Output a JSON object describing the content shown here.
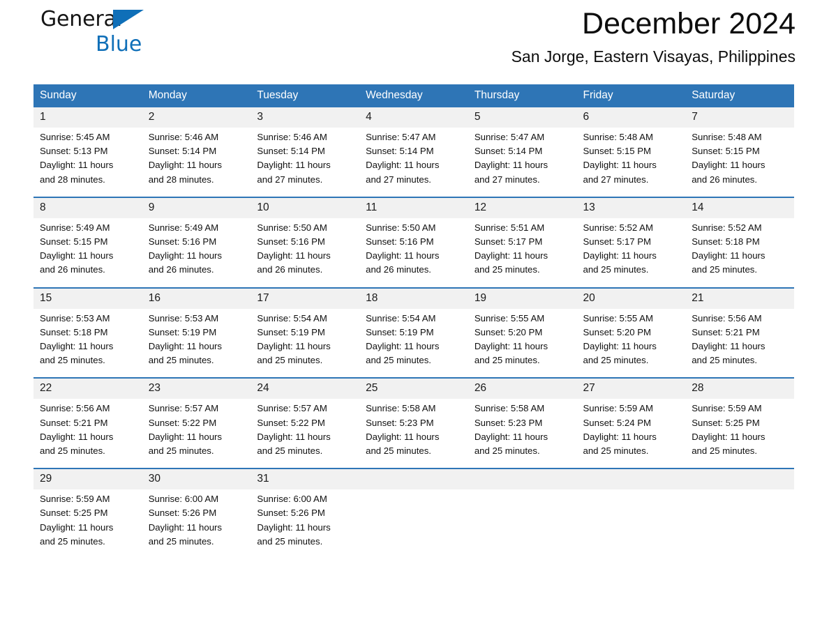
{
  "brand": {
    "name_part1": "General",
    "name_part2": "Blue",
    "triangle_color": "#0F6FB8"
  },
  "header": {
    "month_title": "December 2024",
    "location": "San Jorge, Eastern Visayas, Philippines"
  },
  "theme": {
    "header_blue": "#2E75B6",
    "daynum_background": "#F1F1F1",
    "text_color": "#101010"
  },
  "calendar": {
    "weekday_headers": [
      "Sunday",
      "Monday",
      "Tuesday",
      "Wednesday",
      "Thursday",
      "Friday",
      "Saturday"
    ],
    "weeks": [
      {
        "daynums": [
          "1",
          "2",
          "3",
          "4",
          "5",
          "6",
          "7"
        ],
        "cells": [
          {
            "sunrise": "Sunrise: 5:45 AM",
            "sunset": "Sunset: 5:13 PM",
            "daylight1": "Daylight: 11 hours",
            "daylight2": "and 28 minutes."
          },
          {
            "sunrise": "Sunrise: 5:46 AM",
            "sunset": "Sunset: 5:14 PM",
            "daylight1": "Daylight: 11 hours",
            "daylight2": "and 28 minutes."
          },
          {
            "sunrise": "Sunrise: 5:46 AM",
            "sunset": "Sunset: 5:14 PM",
            "daylight1": "Daylight: 11 hours",
            "daylight2": "and 27 minutes."
          },
          {
            "sunrise": "Sunrise: 5:47 AM",
            "sunset": "Sunset: 5:14 PM",
            "daylight1": "Daylight: 11 hours",
            "daylight2": "and 27 minutes."
          },
          {
            "sunrise": "Sunrise: 5:47 AM",
            "sunset": "Sunset: 5:14 PM",
            "daylight1": "Daylight: 11 hours",
            "daylight2": "and 27 minutes."
          },
          {
            "sunrise": "Sunrise: 5:48 AM",
            "sunset": "Sunset: 5:15 PM",
            "daylight1": "Daylight: 11 hours",
            "daylight2": "and 27 minutes."
          },
          {
            "sunrise": "Sunrise: 5:48 AM",
            "sunset": "Sunset: 5:15 PM",
            "daylight1": "Daylight: 11 hours",
            "daylight2": "and 26 minutes."
          }
        ]
      },
      {
        "daynums": [
          "8",
          "9",
          "10",
          "11",
          "12",
          "13",
          "14"
        ],
        "cells": [
          {
            "sunrise": "Sunrise: 5:49 AM",
            "sunset": "Sunset: 5:15 PM",
            "daylight1": "Daylight: 11 hours",
            "daylight2": "and 26 minutes."
          },
          {
            "sunrise": "Sunrise: 5:49 AM",
            "sunset": "Sunset: 5:16 PM",
            "daylight1": "Daylight: 11 hours",
            "daylight2": "and 26 minutes."
          },
          {
            "sunrise": "Sunrise: 5:50 AM",
            "sunset": "Sunset: 5:16 PM",
            "daylight1": "Daylight: 11 hours",
            "daylight2": "and 26 minutes."
          },
          {
            "sunrise": "Sunrise: 5:50 AM",
            "sunset": "Sunset: 5:16 PM",
            "daylight1": "Daylight: 11 hours",
            "daylight2": "and 26 minutes."
          },
          {
            "sunrise": "Sunrise: 5:51 AM",
            "sunset": "Sunset: 5:17 PM",
            "daylight1": "Daylight: 11 hours",
            "daylight2": "and 25 minutes."
          },
          {
            "sunrise": "Sunrise: 5:52 AM",
            "sunset": "Sunset: 5:17 PM",
            "daylight1": "Daylight: 11 hours",
            "daylight2": "and 25 minutes."
          },
          {
            "sunrise": "Sunrise: 5:52 AM",
            "sunset": "Sunset: 5:18 PM",
            "daylight1": "Daylight: 11 hours",
            "daylight2": "and 25 minutes."
          }
        ]
      },
      {
        "daynums": [
          "15",
          "16",
          "17",
          "18",
          "19",
          "20",
          "21"
        ],
        "cells": [
          {
            "sunrise": "Sunrise: 5:53 AM",
            "sunset": "Sunset: 5:18 PM",
            "daylight1": "Daylight: 11 hours",
            "daylight2": "and 25 minutes."
          },
          {
            "sunrise": "Sunrise: 5:53 AM",
            "sunset": "Sunset: 5:19 PM",
            "daylight1": "Daylight: 11 hours",
            "daylight2": "and 25 minutes."
          },
          {
            "sunrise": "Sunrise: 5:54 AM",
            "sunset": "Sunset: 5:19 PM",
            "daylight1": "Daylight: 11 hours",
            "daylight2": "and 25 minutes."
          },
          {
            "sunrise": "Sunrise: 5:54 AM",
            "sunset": "Sunset: 5:19 PM",
            "daylight1": "Daylight: 11 hours",
            "daylight2": "and 25 minutes."
          },
          {
            "sunrise": "Sunrise: 5:55 AM",
            "sunset": "Sunset: 5:20 PM",
            "daylight1": "Daylight: 11 hours",
            "daylight2": "and 25 minutes."
          },
          {
            "sunrise": "Sunrise: 5:55 AM",
            "sunset": "Sunset: 5:20 PM",
            "daylight1": "Daylight: 11 hours",
            "daylight2": "and 25 minutes."
          },
          {
            "sunrise": "Sunrise: 5:56 AM",
            "sunset": "Sunset: 5:21 PM",
            "daylight1": "Daylight: 11 hours",
            "daylight2": "and 25 minutes."
          }
        ]
      },
      {
        "daynums": [
          "22",
          "23",
          "24",
          "25",
          "26",
          "27",
          "28"
        ],
        "cells": [
          {
            "sunrise": "Sunrise: 5:56 AM",
            "sunset": "Sunset: 5:21 PM",
            "daylight1": "Daylight: 11 hours",
            "daylight2": "and 25 minutes."
          },
          {
            "sunrise": "Sunrise: 5:57 AM",
            "sunset": "Sunset: 5:22 PM",
            "daylight1": "Daylight: 11 hours",
            "daylight2": "and 25 minutes."
          },
          {
            "sunrise": "Sunrise: 5:57 AM",
            "sunset": "Sunset: 5:22 PM",
            "daylight1": "Daylight: 11 hours",
            "daylight2": "and 25 minutes."
          },
          {
            "sunrise": "Sunrise: 5:58 AM",
            "sunset": "Sunset: 5:23 PM",
            "daylight1": "Daylight: 11 hours",
            "daylight2": "and 25 minutes."
          },
          {
            "sunrise": "Sunrise: 5:58 AM",
            "sunset": "Sunset: 5:23 PM",
            "daylight1": "Daylight: 11 hours",
            "daylight2": "and 25 minutes."
          },
          {
            "sunrise": "Sunrise: 5:59 AM",
            "sunset": "Sunset: 5:24 PM",
            "daylight1": "Daylight: 11 hours",
            "daylight2": "and 25 minutes."
          },
          {
            "sunrise": "Sunrise: 5:59 AM",
            "sunset": "Sunset: 5:25 PM",
            "daylight1": "Daylight: 11 hours",
            "daylight2": "and 25 minutes."
          }
        ]
      },
      {
        "daynums": [
          "29",
          "30",
          "31",
          "",
          "",
          "",
          ""
        ],
        "cells": [
          {
            "sunrise": "Sunrise: 5:59 AM",
            "sunset": "Sunset: 5:25 PM",
            "daylight1": "Daylight: 11 hours",
            "daylight2": "and 25 minutes."
          },
          {
            "sunrise": "Sunrise: 6:00 AM",
            "sunset": "Sunset: 5:26 PM",
            "daylight1": "Daylight: 11 hours",
            "daylight2": "and 25 minutes."
          },
          {
            "sunrise": "Sunrise: 6:00 AM",
            "sunset": "Sunset: 5:26 PM",
            "daylight1": "Daylight: 11 hours",
            "daylight2": "and 25 minutes."
          },
          {
            "sunrise": "",
            "sunset": "",
            "daylight1": "",
            "daylight2": ""
          },
          {
            "sunrise": "",
            "sunset": "",
            "daylight1": "",
            "daylight2": ""
          },
          {
            "sunrise": "",
            "sunset": "",
            "daylight1": "",
            "daylight2": ""
          },
          {
            "sunrise": "",
            "sunset": "",
            "daylight1": "",
            "daylight2": ""
          }
        ]
      }
    ]
  }
}
